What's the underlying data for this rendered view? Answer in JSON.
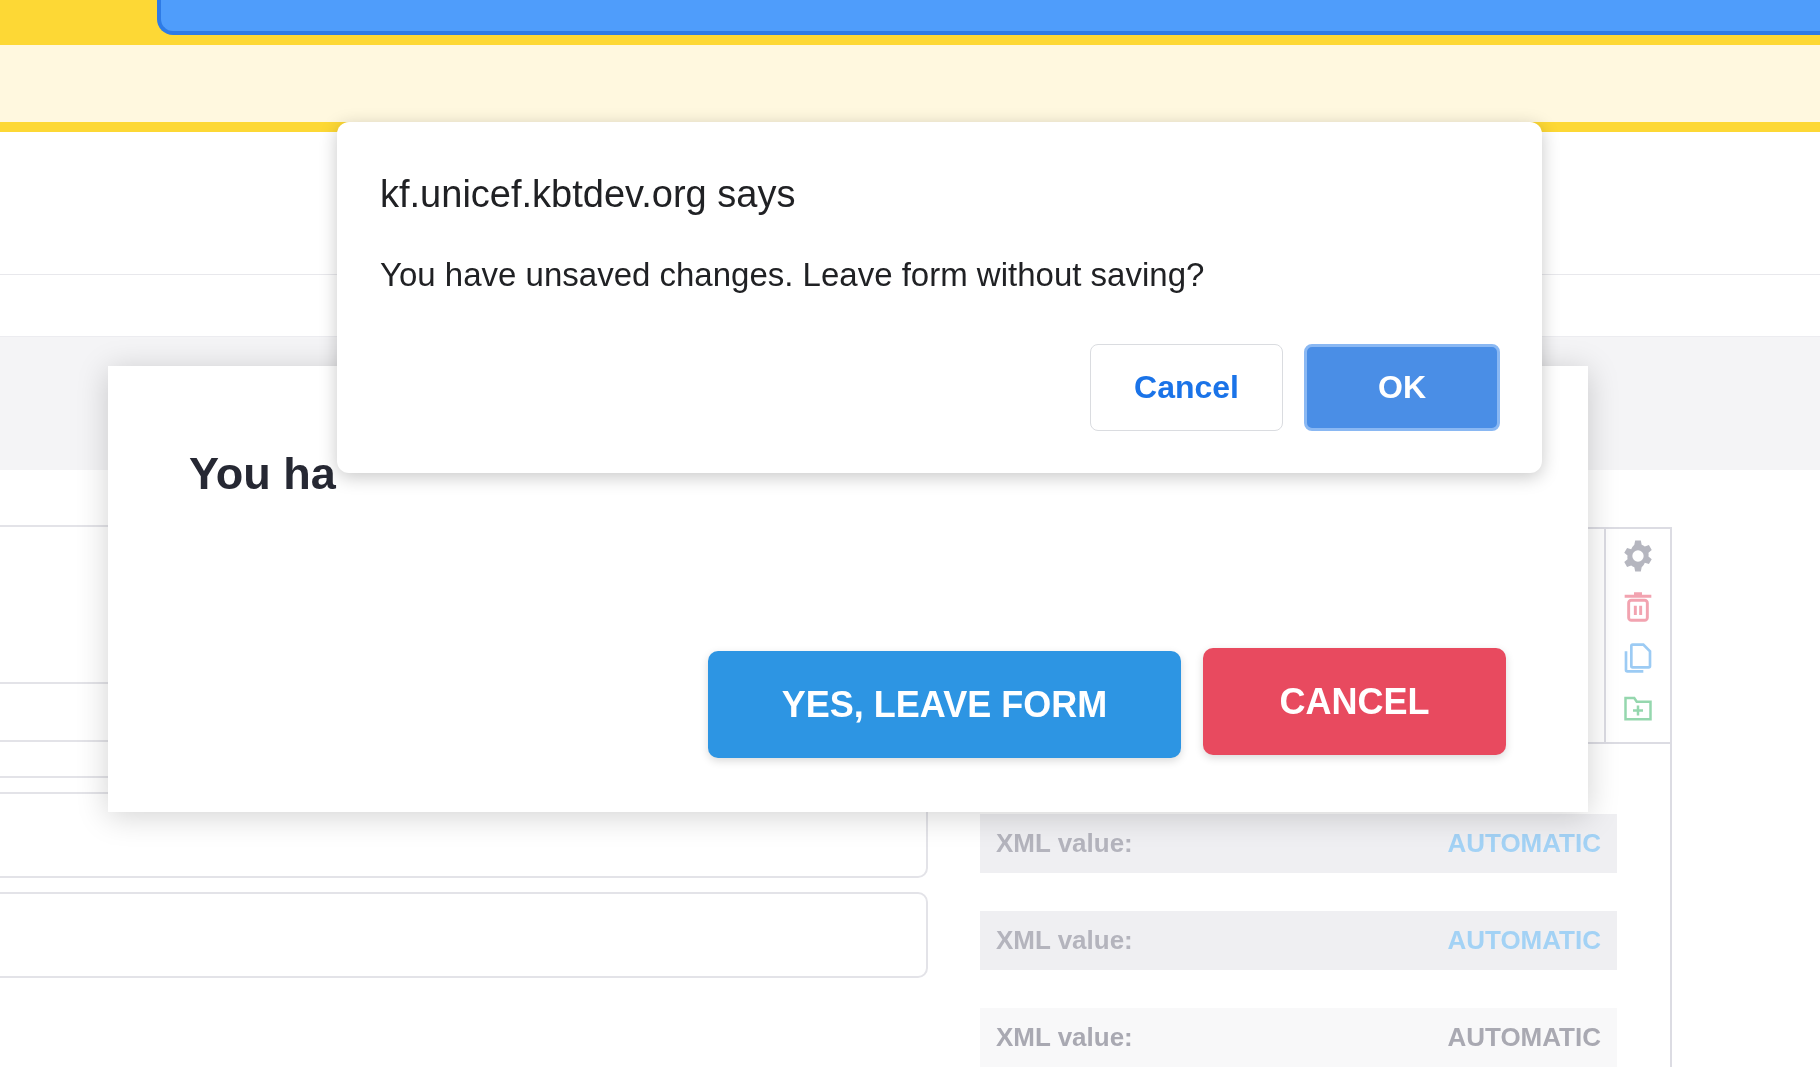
{
  "browser_dialog": {
    "title": "kf.unicef.kbtdev.org says",
    "message": "You have unsaved changes. Leave form without saving?",
    "buttons": [
      {
        "label": "Cancel",
        "kind": "secondary"
      },
      {
        "label": "OK",
        "kind": "primary"
      }
    ]
  },
  "modal": {
    "title": "You ha",
    "buttons": [
      {
        "label": "YES, LEAVE FORM",
        "kind": "confirm"
      },
      {
        "label": "CANCEL",
        "kind": "danger"
      }
    ]
  },
  "xml_rows": [
    {
      "label": "XML value:",
      "value": "AUTOMATIC",
      "disabled": false
    },
    {
      "label": "XML value:",
      "value": "AUTOMATIC",
      "disabled": false
    },
    {
      "label": "XML value:",
      "value": "AUTOMATIC",
      "disabled": true
    }
  ]
}
